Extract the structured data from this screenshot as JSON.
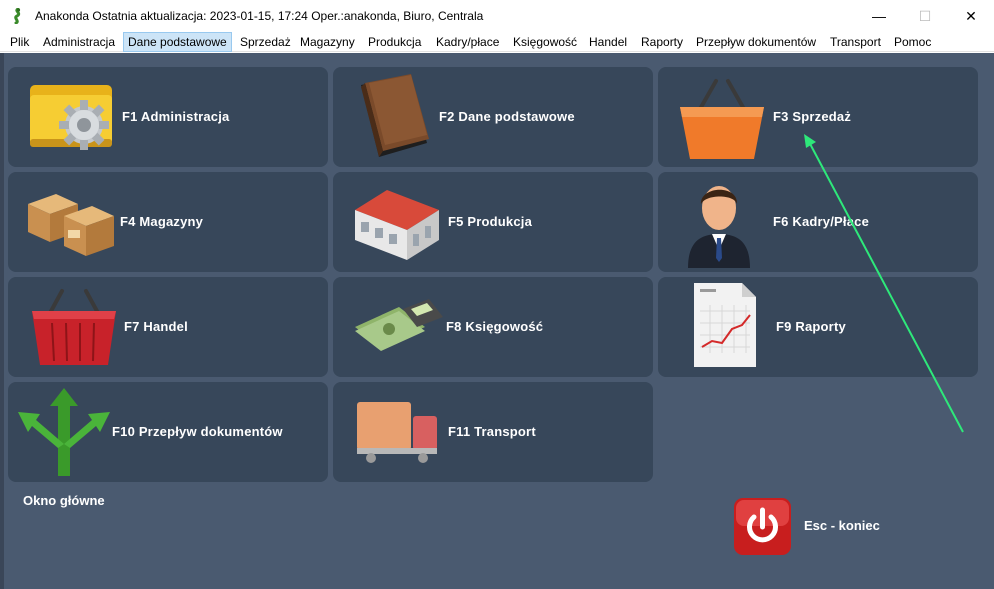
{
  "window": {
    "title": "Anakonda Ostatnia aktualizacja: 2023-01-15, 17:24 Oper.:anakonda, Biuro, Centrala",
    "minimize_glyph": "—",
    "maximize_glyph": "☐",
    "close_glyph": "✕"
  },
  "menu": {
    "items": [
      {
        "label": "Plik"
      },
      {
        "label": "Administracja"
      },
      {
        "label": "Dane podstawowe"
      },
      {
        "label": "Sprzedaż"
      },
      {
        "label": "Magazyny"
      },
      {
        "label": "Produkcja"
      },
      {
        "label": "Kadry/płace"
      },
      {
        "label": "Księgowość"
      },
      {
        "label": "Handel"
      },
      {
        "label": "Raporty"
      },
      {
        "label": "Przepływ dokumentów"
      },
      {
        "label": "Transport"
      },
      {
        "label": "Pomoc"
      }
    ],
    "active_index": 2
  },
  "tiles": [
    {
      "label": "F1  Administracja",
      "icon": "gear-folder-icon"
    },
    {
      "label": "F2  Dane podstawowe",
      "icon": "book-icon"
    },
    {
      "label": "F3  Sprzedaż",
      "icon": "shopping-basket-icon"
    },
    {
      "label": "F4  Magazyny",
      "icon": "boxes-icon"
    },
    {
      "label": "F5  Produkcja",
      "icon": "factory-icon"
    },
    {
      "label": "F6  Kadry/Płace",
      "icon": "person-icon"
    },
    {
      "label": "F7  Handel",
      "icon": "red-basket-icon"
    },
    {
      "label": "F8  Księgowość",
      "icon": "money-calculator-icon"
    },
    {
      "label": "F9  Raporty",
      "icon": "report-chart-icon"
    },
    {
      "label": "F10  Przepływ dokumentów",
      "icon": "green-arrows-icon"
    },
    {
      "label": "F11  Transport",
      "icon": "truck-icon"
    }
  ],
  "footer": {
    "window_label": "Okno główne",
    "exit_label": "Esc - koniec",
    "exit_icon": "power-icon"
  },
  "colors": {
    "background": "#4a5a70",
    "tile": "#37475a",
    "annotation_arrow": "#2ee87a"
  }
}
